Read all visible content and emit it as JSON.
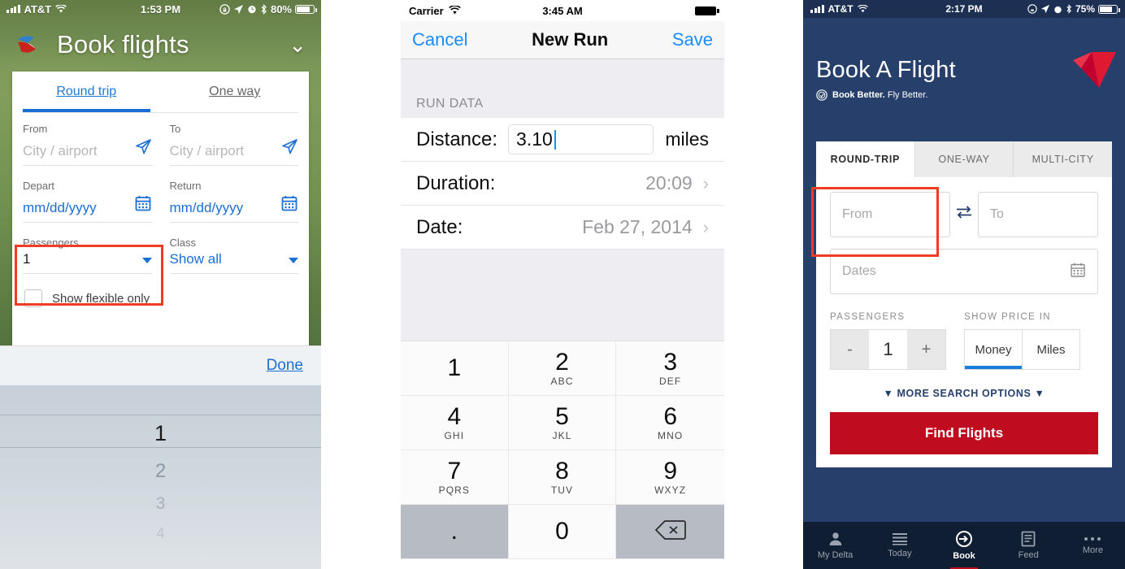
{
  "southwest": {
    "status": {
      "carrier": "AT&T",
      "time": "1:53 PM",
      "battery": "80%",
      "icons": [
        "signal-bars-icon",
        "wifi-icon",
        "rotation-lock-icon",
        "location-arrow-icon",
        "alarm-clock-icon",
        "bluetooth-icon",
        "battery-icon"
      ]
    },
    "app_title": "Book flights",
    "collapse_icon": "chevron-down-icon",
    "logo_icon": "southwest-heart-logo",
    "tabs": [
      {
        "label": "Round trip",
        "active": true
      },
      {
        "label": "One way",
        "active": false
      }
    ],
    "fields": {
      "from_label": "From",
      "from_placeholder": "City / airport",
      "to_label": "To",
      "to_placeholder": "City / airport",
      "depart_label": "Depart",
      "depart_placeholder": "mm/dd/yyyy",
      "return_label": "Return",
      "return_placeholder": "mm/dd/yyyy",
      "passengers_label": "Passengers",
      "passengers_value": "1",
      "class_label": "Class",
      "class_value": "Show all"
    },
    "flexible_label": "Show flexible only",
    "done_label": "Done",
    "picker": {
      "selected": "1",
      "options": [
        "1",
        "2",
        "3",
        "4"
      ]
    },
    "highlight_color": "#f23b25"
  },
  "newrun": {
    "status": {
      "carrier": "Carrier",
      "time": "3:45 AM"
    },
    "nav": {
      "cancel": "Cancel",
      "title": "New Run",
      "save": "Save"
    },
    "section_header": "RUN DATA",
    "rows": [
      {
        "label": "Distance:",
        "value": "3.10",
        "unit": "miles"
      },
      {
        "label": "Duration:",
        "value": "20:09",
        "chevron": true
      },
      {
        "label": "Date:",
        "value": "Feb 27, 2014",
        "chevron": true
      }
    ],
    "keypad": [
      {
        "num": "1",
        "sub": ""
      },
      {
        "num": "2",
        "sub": "ABC"
      },
      {
        "num": "3",
        "sub": "DEF"
      },
      {
        "num": "4",
        "sub": "GHI"
      },
      {
        "num": "5",
        "sub": "JKL"
      },
      {
        "num": "6",
        "sub": "MNO"
      },
      {
        "num": "7",
        "sub": "PQRS"
      },
      {
        "num": "8",
        "sub": "TUV"
      },
      {
        "num": "9",
        "sub": "WXYZ"
      },
      {
        "num": ".",
        "sub": "",
        "gray": true
      },
      {
        "num": "0",
        "sub": ""
      },
      {
        "num": "",
        "sub": "",
        "gray": true,
        "icon": "backspace-icon"
      }
    ]
  },
  "delta": {
    "status": {
      "carrier": "AT&T",
      "time": "2:17 PM",
      "battery": "75%"
    },
    "title": "Book A Flight",
    "tagline_bold": "Book Better.",
    "tagline_rest": "Fly Better.",
    "logo_icon": "delta-widget-logo",
    "tabs": [
      {
        "label": "ROUND-TRIP",
        "active": true
      },
      {
        "label": "ONE-WAY",
        "active": false
      },
      {
        "label": "MULTI-CITY",
        "active": false
      }
    ],
    "from_placeholder": "From",
    "to_placeholder": "To",
    "swap_icon": "swap-arrows-icon",
    "dates_placeholder": "Dates",
    "calendar_icon": "calendar-icon",
    "passengers_label": "PASSENGERS",
    "passengers_minus": "-",
    "passengers_value": "1",
    "passengers_plus": "+",
    "price_label": "SHOW PRICE IN",
    "price_options": [
      {
        "label": "Money",
        "active": true
      },
      {
        "label": "Miles",
        "active": false
      }
    ],
    "more_options": "▼ MORE SEARCH OPTIONS ▼",
    "find_flights": "Find Flights",
    "tabbar": [
      {
        "label": "My Delta",
        "icon": "person-icon",
        "active": false
      },
      {
        "label": "Today",
        "icon": "list-lines-icon",
        "active": false
      },
      {
        "label": "Book",
        "icon": "book-arrow-icon",
        "active": true
      },
      {
        "label": "Feed",
        "icon": "document-icon",
        "active": false
      },
      {
        "label": "More",
        "icon": "ellipsis-icon",
        "active": false
      }
    ],
    "highlight_color": "#f23b25",
    "brand_red": "#c00c1f",
    "brand_navy": "#27406b"
  }
}
